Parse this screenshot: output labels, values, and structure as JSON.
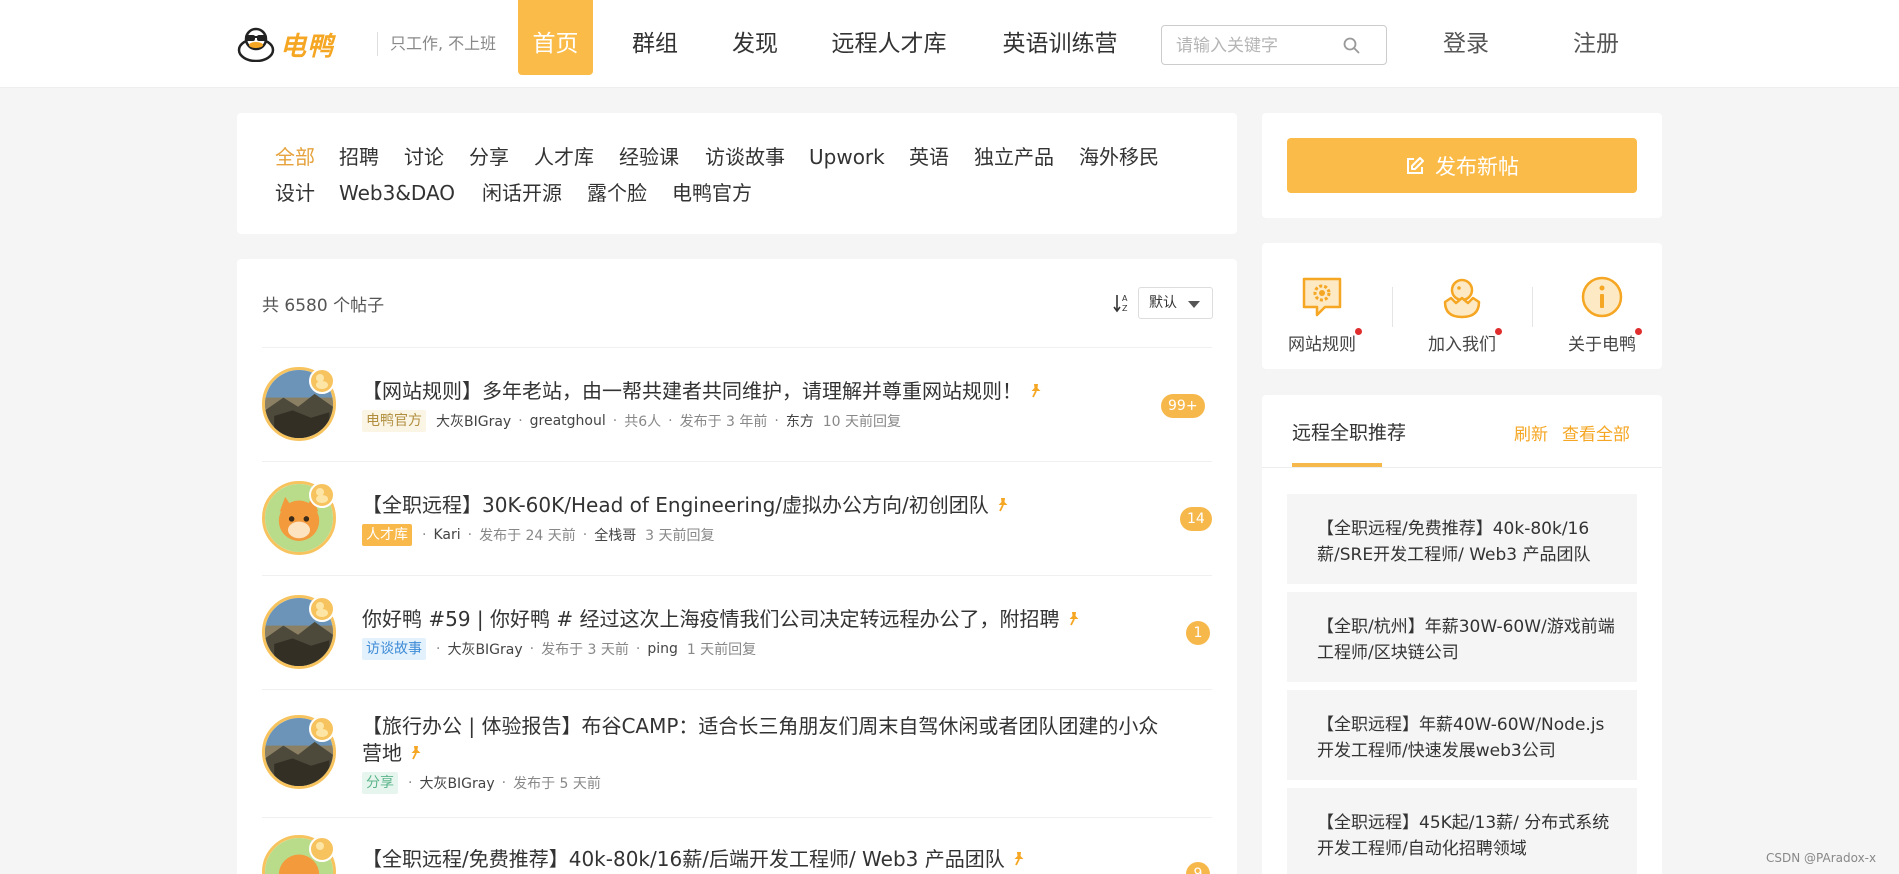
{
  "header": {
    "logo_text": "电鸭",
    "slogan": "只工作, 不上班",
    "nav": [
      "首页",
      "群组",
      "发现",
      "远程人才库",
      "英语训练营"
    ],
    "search_placeholder": "请输入关键字",
    "login": "登录",
    "register": "注册"
  },
  "categories": {
    "row1": [
      "全部",
      "招聘",
      "讨论",
      "分享",
      "人才库",
      "经验课",
      "访谈故事",
      "Upwork",
      "英语",
      "独立产品",
      "海外移民"
    ],
    "row2": [
      "设计",
      "Web3&DAO",
      "闲话开源",
      "露个脸",
      "电鸭官方"
    ],
    "active": "全部"
  },
  "posts_header": {
    "count": "共 6580 个帖子",
    "sort": "默认"
  },
  "posts": [
    {
      "title": "【网站规则】多年老站，由一帮共建者共同维护，请理解并尊重网站规则！",
      "tag": "电鸭官方",
      "author": "大灰BIGray",
      "extra_user": "greatghoul",
      "participants": "共6人",
      "posted": "发布于 3 年前",
      "replier": "东方",
      "replied": "10 天前回复",
      "replies": "99+"
    },
    {
      "title": "【全职远程】30K-60K/Head of Engineering/虚拟办公方向/初创团队",
      "tag": "人才库",
      "author": "Kari",
      "posted": "发布于 24 天前",
      "replier": "全栈哥",
      "replied": "3 天前回复",
      "replies": "14"
    },
    {
      "title": "你好鸭 #59 | 你好鸭 # 经过这次上海疫情我们公司决定转远程办公了，附招聘",
      "tag": "访谈故事",
      "author": "大灰BIGray",
      "posted": "发布于 3 天前",
      "replier": "ping",
      "replied": "1 天前回复",
      "replies": "1"
    },
    {
      "title_line1": "【旅行办公 | 体验报告】布谷CAMP：适合长三角朋友们周末自驾休闲或者团队团建的小众",
      "title_line2": "营地",
      "tag": "分享",
      "author": "大灰BIGray",
      "posted": "发布于 5 天前"
    },
    {
      "title": "【全职远程/免费推荐】40k-80k/16薪/后端开发工程师/ Web3 产品团队",
      "replies": "9"
    }
  ],
  "sidebar": {
    "publish": "发布新帖",
    "quick_links": [
      "网站规则",
      "加入我们",
      "关于电鸭"
    ],
    "rec_title": "远程全职推荐",
    "refresh": "刷新",
    "view_all": "查看全部",
    "jobs": [
      "【全职远程/免费推荐】40k-80k/16薪/SRE开发工程师/ Web3 产品团队",
      "【全职/杭州】年薪30W-60W/游戏前端工程师/区块链公司",
      "【全职远程】年薪40W-60W/Node.js开发工程师/快速发展web3公司",
      "【全职远程】45K起/13薪/ 分布式系统开发工程师/自动化招聘领域"
    ]
  },
  "watermark": "CSDN @PAradox-x",
  "colors": {
    "accent": "#fbbb48",
    "accent_text": "#e6a23c"
  }
}
